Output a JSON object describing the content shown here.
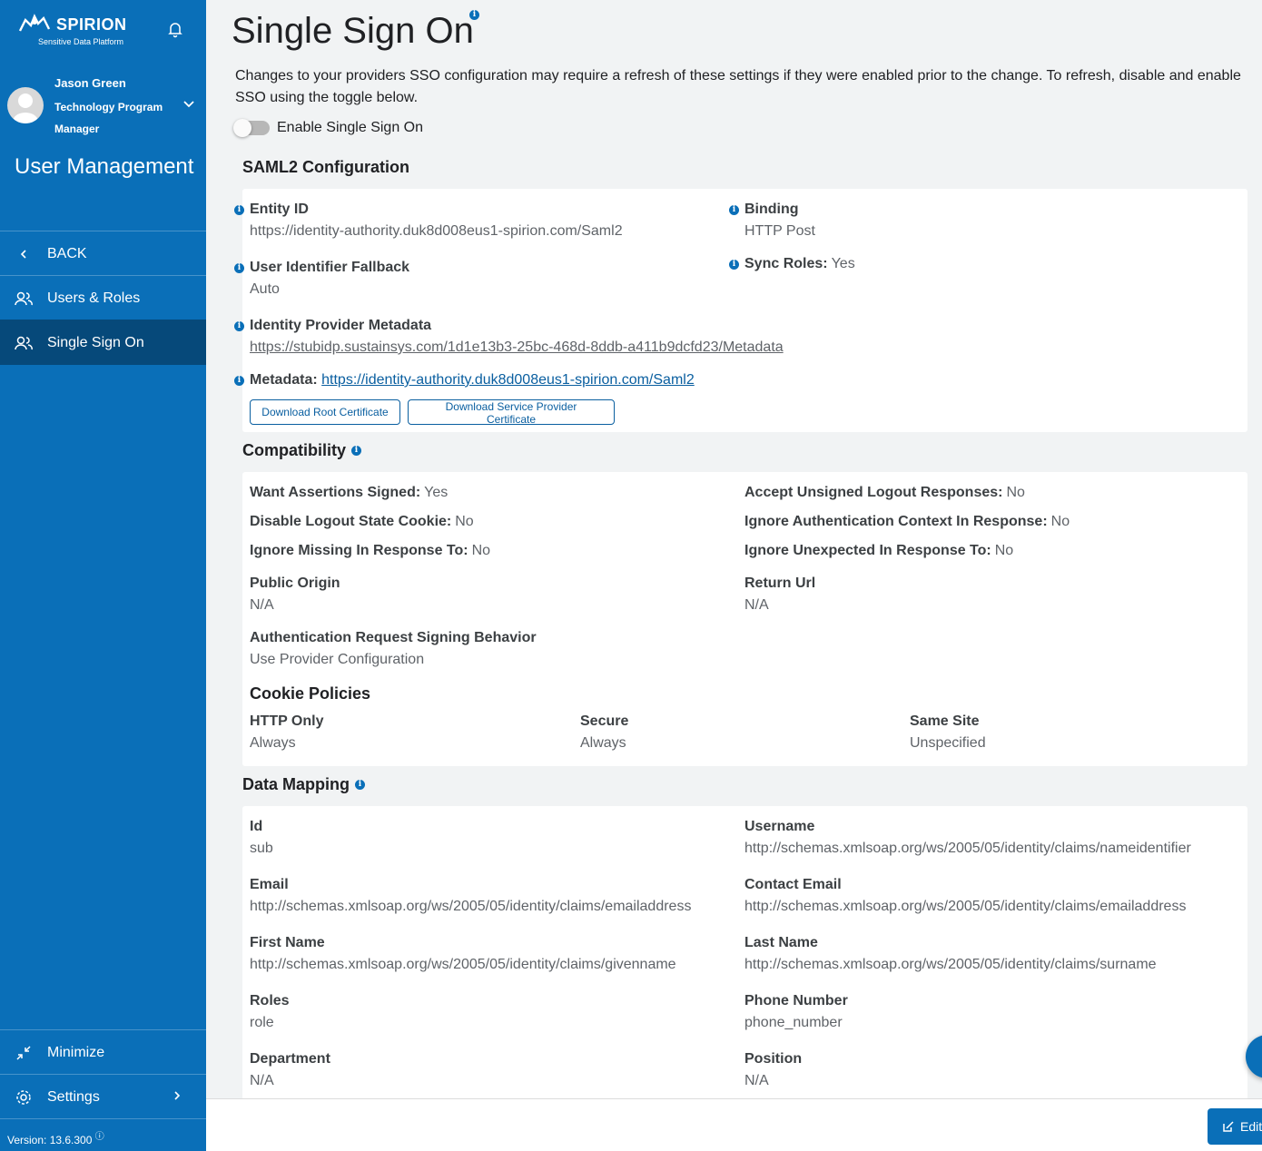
{
  "sidebar": {
    "brand": "SPIRION",
    "tagline": "Sensitive Data Platform",
    "user_name": "Jason Green",
    "user_role": "Technology Program Manager",
    "section_title": "User Management",
    "nav": {
      "back": "BACK",
      "users_roles": "Users & Roles",
      "sso": "Single Sign On",
      "minimize": "Minimize",
      "settings": "Settings"
    },
    "version": "Version: 13.6.300"
  },
  "page": {
    "title": "Single Sign On",
    "intro": "Changes to your providers SSO configuration may require a refresh of these settings if they were enabled prior to the change. To refresh, disable and enable SSO using the toggle below.",
    "toggle_label": "Enable Single Sign On",
    "toggle_on": false
  },
  "saml": {
    "heading": "SAML2 Configuration",
    "entity_id_label": "Entity ID",
    "entity_id_value": "https://identity-authority.duk8d008eus1-spirion.com/Saml2",
    "binding_label": "Binding",
    "binding_value": "HTTP Post",
    "fallback_label": "User Identifier Fallback",
    "fallback_value": "Auto",
    "sync_roles_label": "Sync Roles:",
    "sync_roles_value": "Yes",
    "idp_metadata_label": "Identity Provider Metadata",
    "idp_metadata_value": "https://stubidp.sustainsys.com/1d1e13b3-25bc-468d-8ddb-a411b9dcfd23/Metadata",
    "metadata_label": "Metadata:",
    "metadata_value": "https://identity-authority.duk8d008eus1-spirion.com/Saml2",
    "btn_root_cert": "Download Root Certificate",
    "btn_sp_cert": "Download Service Provider Certificate"
  },
  "compat": {
    "heading": "Compatibility",
    "want_assertions_label": "Want Assertions Signed:",
    "want_assertions_value": "Yes",
    "accept_unsigned_label": "Accept Unsigned Logout Responses:",
    "accept_unsigned_value": "No",
    "disable_logout_label": "Disable Logout State Cookie:",
    "disable_logout_value": "No",
    "ignore_auth_ctx_label": "Ignore Authentication Context In Response:",
    "ignore_auth_ctx_value": "No",
    "ignore_missing_label": "Ignore Missing In Response To:",
    "ignore_missing_value": "No",
    "ignore_unexpected_label": "Ignore Unexpected In Response To:",
    "ignore_unexpected_value": "No",
    "public_origin_label": "Public Origin",
    "public_origin_value": "N/A",
    "return_url_label": "Return Url",
    "return_url_value": "N/A",
    "auth_signing_label": "Authentication Request Signing Behavior",
    "auth_signing_value": "Use Provider Configuration",
    "cookie_heading": "Cookie Policies",
    "http_only_label": "HTTP Only",
    "http_only_value": "Always",
    "secure_label": "Secure",
    "secure_value": "Always",
    "same_site_label": "Same Site",
    "same_site_value": "Unspecified"
  },
  "mapping": {
    "heading": "Data Mapping",
    "id_label": "Id",
    "id_value": "sub",
    "username_label": "Username",
    "username_value": "http://schemas.xmlsoap.org/ws/2005/05/identity/claims/nameidentifier",
    "email_label": "Email",
    "email_value": "http://schemas.xmlsoap.org/ws/2005/05/identity/claims/emailaddress",
    "contact_email_label": "Contact Email",
    "contact_email_value": "http://schemas.xmlsoap.org/ws/2005/05/identity/claims/emailaddress",
    "first_name_label": "First Name",
    "first_name_value": "http://schemas.xmlsoap.org/ws/2005/05/identity/claims/givenname",
    "last_name_label": "Last Name",
    "last_name_value": "http://schemas.xmlsoap.org/ws/2005/05/identity/claims/surname",
    "roles_label": "Roles",
    "roles_value": "role",
    "phone_label": "Phone Number",
    "phone_value": "phone_number",
    "department_label": "Department",
    "department_value": "N/A",
    "position_label": "Position",
    "position_value": "N/A"
  },
  "footer": {
    "edit_label": "Edit"
  },
  "colors": {
    "primary": "#0a6fb8",
    "primary_dark": "#06497a",
    "link": "#0a5fa0"
  }
}
